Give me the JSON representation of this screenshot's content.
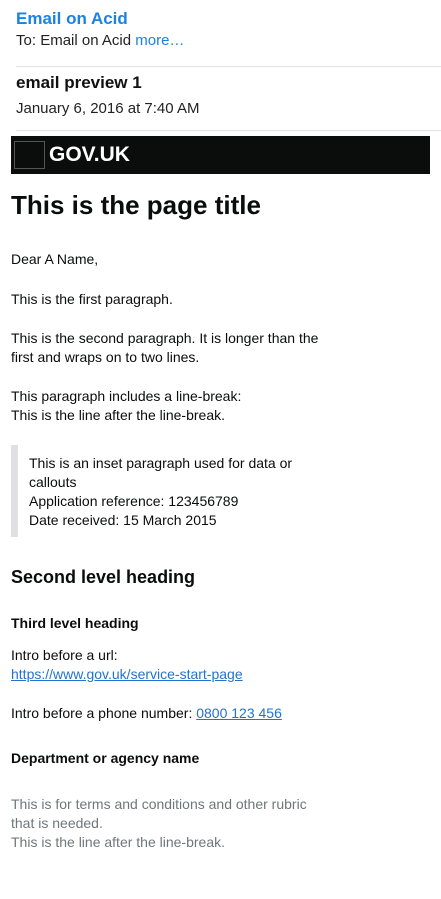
{
  "mail": {
    "sender": "Email on Acid",
    "to_label": "To:",
    "to_value": "Email on Acid",
    "more_label": "more…",
    "subject": "email preview 1",
    "date": "January 6, 2016 at 7:40 AM"
  },
  "govuk": {
    "logo_text": "GOV.UK"
  },
  "body": {
    "page_title": "This is the page title",
    "salutation": "Dear A Name,",
    "p1": "This is the first paragraph.",
    "p2_line1": "This is the second paragraph. It is longer than the",
    "p2_line2": "first and wraps on to two lines.",
    "p3_line1": "This paragraph includes a line-break:",
    "p3_line2": "This is the line after the line-break.",
    "inset": {
      "line1": "This is an inset paragraph used for data or",
      "line2": "callouts",
      "line3": "Application reference: 123456789",
      "line4": "Date received: 15 March 2015"
    },
    "h2": "Second level heading",
    "h3": "Third level heading",
    "url_intro": "Intro before a url:",
    "url": "https://www.gov.uk/service-start-page",
    "phone_intro": "Intro before a phone number:",
    "phone": "0800 123 456",
    "department": "Department or agency name",
    "rubric_line1": "This is for terms and conditions and other rubric",
    "rubric_line2": "that is needed.",
    "rubric_line3": "This is the line after the line-break."
  },
  "colors": {
    "mail_link": "#1a82e2",
    "gov_bar": "#0b0c0c",
    "link": "#2273ce",
    "inset_border": "#dee0e2",
    "rubric": "#6f777b"
  }
}
